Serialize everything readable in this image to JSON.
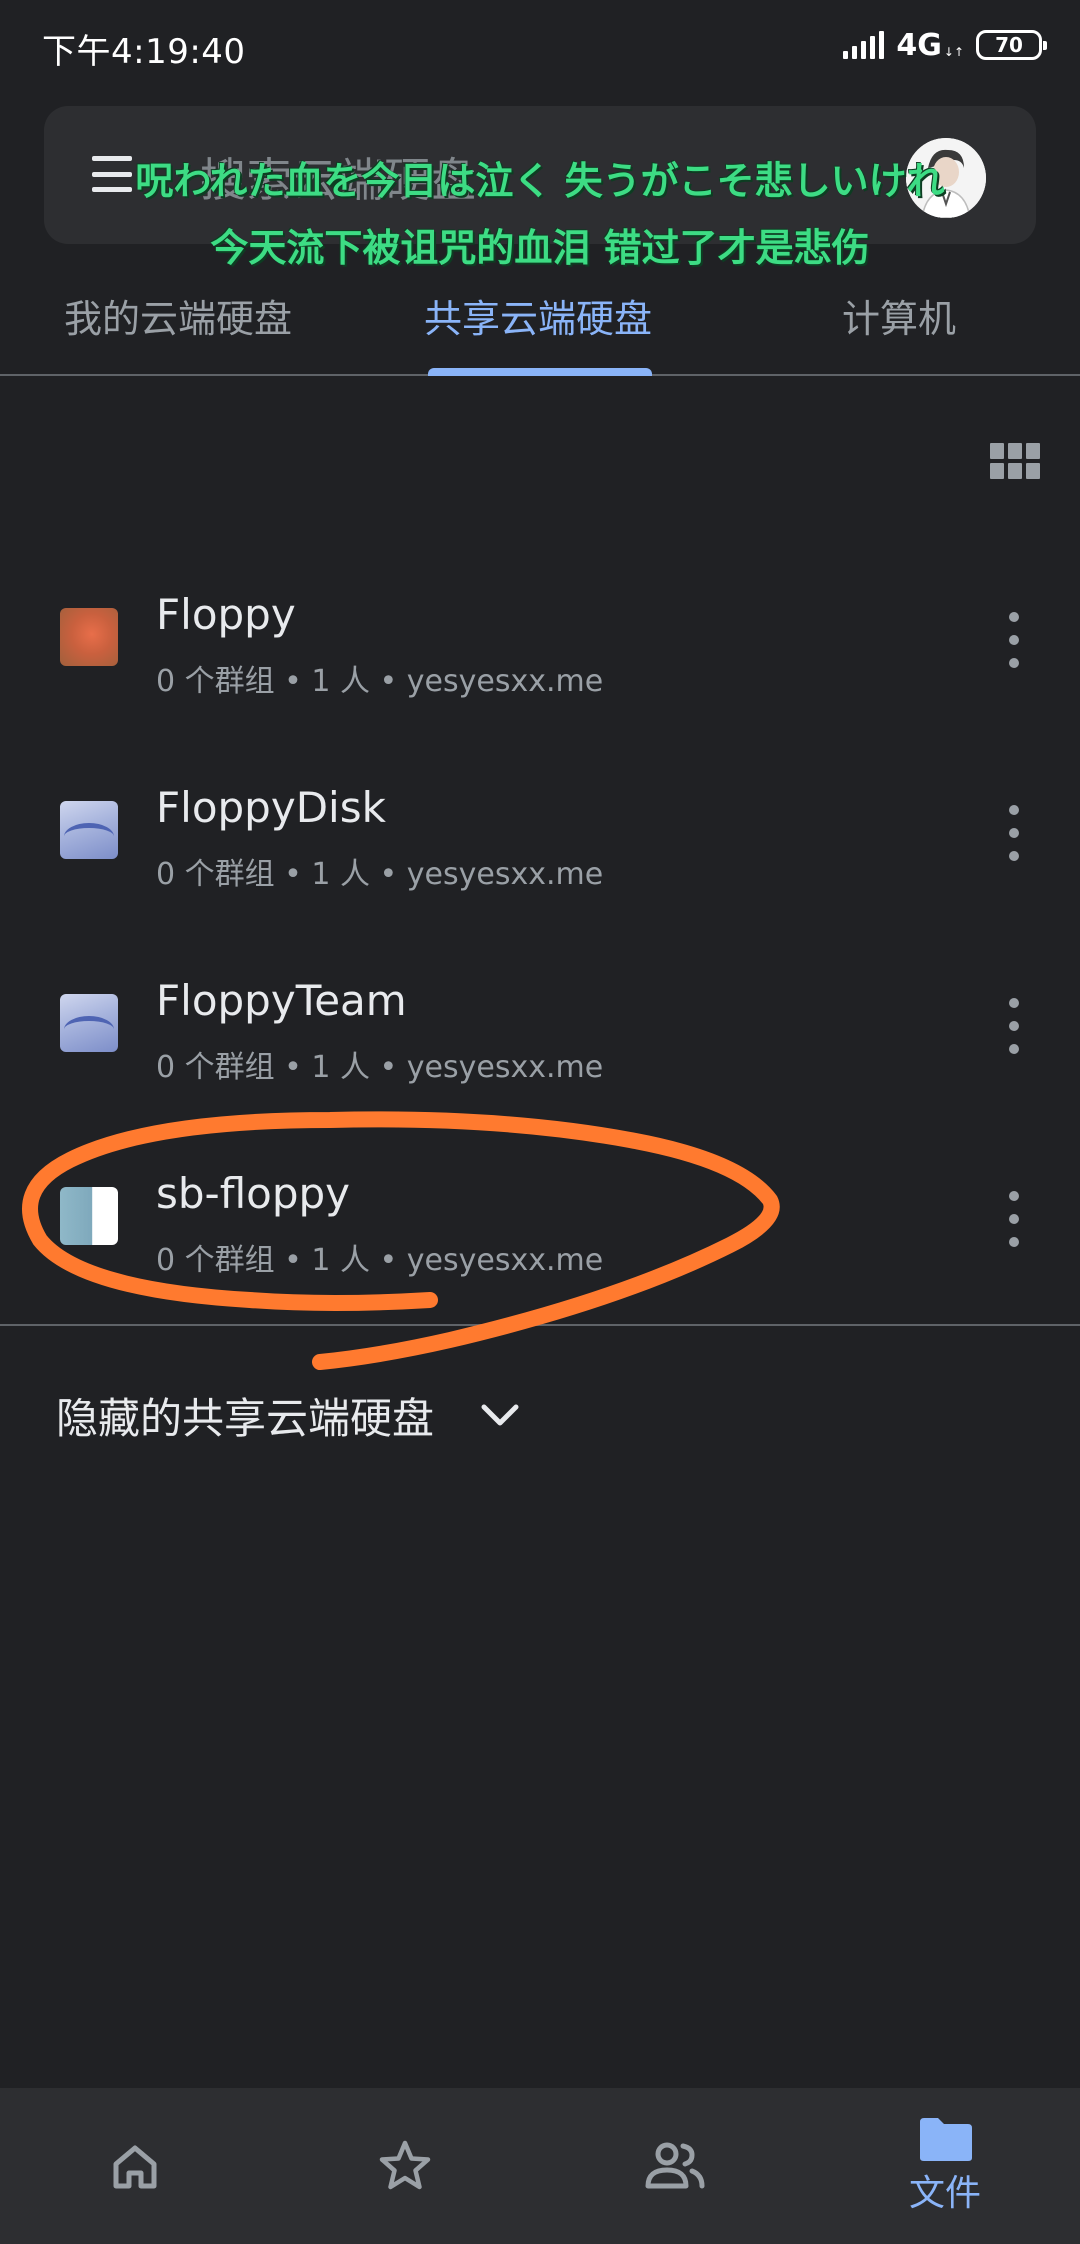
{
  "status_bar": {
    "time": "下午4:19:40",
    "network": "4G",
    "battery": "70"
  },
  "search": {
    "placeholder": "搜索云端硬盘"
  },
  "subtitles": {
    "japanese": "呪われた血を今日は泣く 失うがこそ悲しいけれ",
    "chinese": "今天流下被诅咒的血泪 错过了才是悲伤"
  },
  "tabs": [
    {
      "label": "我的云端硬盘",
      "selected": false
    },
    {
      "label": "共享云端硬盘",
      "selected": true
    },
    {
      "label": "计算机",
      "selected": false
    }
  ],
  "shared_drives": [
    {
      "name": "Floppy",
      "meta": "0 个群组 • 1 人 • yesyesxx.me",
      "thumbnail": "orange-photo"
    },
    {
      "name": "FloppyDisk",
      "meta": "0 个群组 • 1 人 • yesyesxx.me",
      "thumbnail": "blue-wave"
    },
    {
      "name": "FloppyTeam",
      "meta": "0 个群组 • 1 人 • yesyesxx.me",
      "thumbnail": "blue-wave"
    },
    {
      "name": "sb-floppy",
      "meta": "0 个群组 • 1 人 • yesyesxx.me",
      "thumbnail": "teal-white"
    }
  ],
  "hidden_section": {
    "label": "隐藏的共享云端硬盘"
  },
  "bottom_nav": {
    "items": [
      {
        "icon": "home-icon",
        "selected": false
      },
      {
        "icon": "star-icon",
        "selected": false
      },
      {
        "icon": "people-icon",
        "selected": false
      },
      {
        "icon": "folder-icon",
        "label": "文件",
        "selected": true
      }
    ]
  },
  "colors": {
    "background": "#202124",
    "accent": "#8ab4f8",
    "annotation": "#ff7a2f",
    "subtitle": "#3ddc84"
  }
}
